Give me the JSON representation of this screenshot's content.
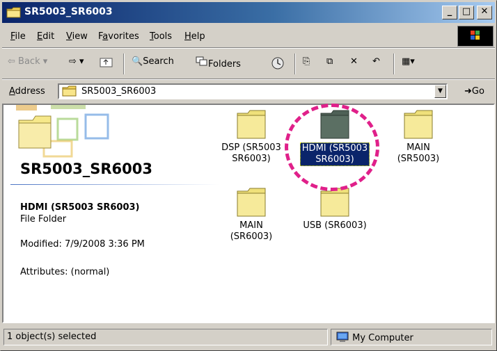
{
  "window": {
    "title": "SR5003_SR6003"
  },
  "menu": [
    {
      "label": "File",
      "key": "F",
      "rest": "ile"
    },
    {
      "label": "Edit",
      "key": "E",
      "rest": "dit"
    },
    {
      "label": "View",
      "key": "V",
      "rest": "iew"
    },
    {
      "label": "Favorites",
      "key": "a",
      "pre": "F",
      "rest": "vorites"
    },
    {
      "label": "Tools",
      "key": "T",
      "rest": "ools"
    },
    {
      "label": "Help",
      "key": "H",
      "rest": "elp"
    }
  ],
  "toolbar": {
    "back": "Back",
    "search": "Search",
    "folders": "Folders"
  },
  "address": {
    "label": "Address",
    "value": "SR5003_SR6003",
    "go": "Go"
  },
  "left_panel": {
    "title": "SR5003_SR6003",
    "selected_name": "HDMI (SR5003 SR6003)",
    "selected_type": "File Folder",
    "modified": "Modified: 7/9/2008 3:36 PM",
    "attributes": "Attributes: (normal)"
  },
  "folders": [
    {
      "line1": "DSP (SR5003",
      "line2": "SR6003)",
      "selected": false
    },
    {
      "line1": "HDMI (SR5003",
      "line2": "SR6003)",
      "selected": true
    },
    {
      "line1": "MAIN",
      "line2": "(SR5003)",
      "selected": false
    },
    {
      "line1": "MAIN",
      "line2": "(SR6003)",
      "selected": false
    },
    {
      "line1": "USB (SR6003)",
      "line2": "",
      "selected": false
    }
  ],
  "status": {
    "selection": "1 object(s) selected",
    "zone": "My Computer"
  },
  "colors": {
    "highlight": "#e0208a",
    "selection_bg": "#0a246a",
    "folder_yellow": "#f6e88a",
    "folder_dark": "#5b6f63"
  }
}
